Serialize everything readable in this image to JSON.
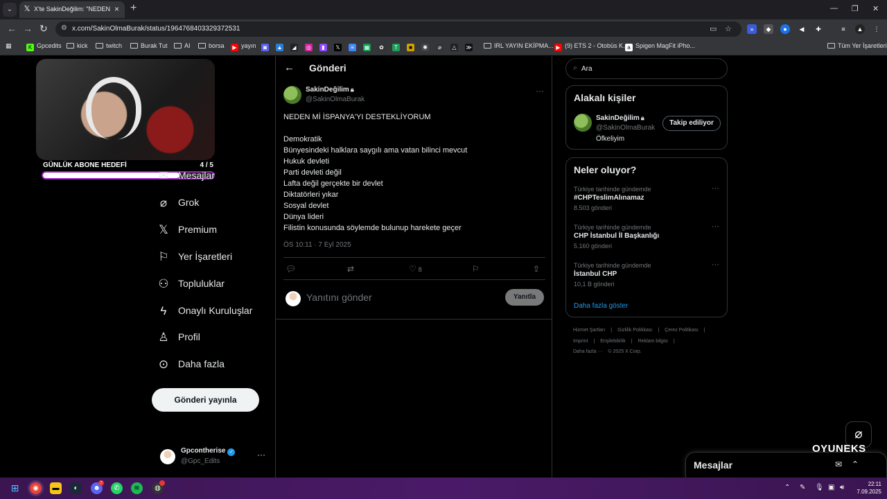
{
  "browser": {
    "tab_title": "X'te SakinDeğilim: \"NEDEN Mİ İSPANYA'YI DESTEKLİYORUM\"",
    "url": "x.com/SakinOlmaBurak/status/1964768403329372531",
    "bookmarks": [
      "Gpcedits",
      "kick",
      "twitch",
      "Burak Tut",
      "AI",
      "borsa",
      "yayın",
      "IRL YAYIN EKİPMA...",
      "(9) ETS 2 - Otobüs K...",
      "Spigen MagFit iPho...",
      "Tüm Yer İşaretleri"
    ]
  },
  "overlay": {
    "goal_label": "GÜNLÜK ABONE HEDEFİ",
    "goal_count": "4 / 5",
    "goal_progress": 0.8
  },
  "nav": {
    "items": [
      {
        "label": "Mesajlar",
        "icon": "mail-icon"
      },
      {
        "label": "Grok",
        "icon": "grok-icon"
      },
      {
        "label": "Premium",
        "icon": "x-logo-icon"
      },
      {
        "label": "Yer İşaretleri",
        "icon": "bookmark-icon"
      },
      {
        "label": "Topluluklar",
        "icon": "communities-icon"
      },
      {
        "label": "Onaylı Kuruluşlar",
        "icon": "lightning-icon"
      },
      {
        "label": "Profil",
        "icon": "profile-icon"
      },
      {
        "label": "Daha fazla",
        "icon": "more-circle-icon"
      }
    ],
    "post_button": "Gönderi yayınla",
    "account_name": "Gpcontherise",
    "account_handle": "@Gpc_Edits"
  },
  "post": {
    "header_title": "Gönderi",
    "author_name": "SakinDeğilim",
    "author_handle": "@SakinOlmaBurak",
    "lines": [
      "NEDEN Mİ İSPANYA'YI DESTEKLİYORUM",
      "",
      "Demokratik",
      "Bünyesindeki halklara saygılı ama vatan bilinci mevcut",
      "Hukuk devleti",
      "Parti devleti değil",
      "Lafta değil gerçekte bir devlet",
      "Diktatörleri yıkar",
      "Sosyal devlet",
      "Dünya lideri",
      "Filistin konusunda söylemde bulunup harekete geçer"
    ],
    "timestamp": "ÖS 10:11 · 7 Eyl 2025",
    "like_count": "8",
    "reply_placeholder": "Yanıtını gönder",
    "reply_button": "Yanıtla"
  },
  "sidebar": {
    "search_placeholder": "Ara",
    "related_title": "Alakalı kişiler",
    "related_name": "SakinDeğilim",
    "related_handle": "@SakinOlmaBurak",
    "related_bio": "Öfkeliyim",
    "follow_button": "Takip ediliyor",
    "trends_title": "Neler oluyor?",
    "trends": [
      {
        "context": "Türkiye tarihinde gündemde",
        "name": "#CHPTeslimAlınamaz",
        "count": "8.503 gönderi"
      },
      {
        "context": "Türkiye tarihinde gündemde",
        "name": "CHP İstanbul İl Başkanlığı",
        "count": "5.160 gönderi"
      },
      {
        "context": "Türkiye tarihinde gündemde",
        "name": "İstanbul CHP",
        "count": "10,1 B gönderi"
      }
    ],
    "show_more": "Daha fazla göster",
    "footer_row1": [
      "Hizmet Şartları",
      "|",
      "Gizlilik Politikası",
      "|",
      "Çerez Politikası",
      "|"
    ],
    "footer_row2": [
      "Imprint",
      "|",
      "Erişilebilirlik",
      "|",
      "Reklam bilgisi",
      "|"
    ],
    "footer_row3": [
      "Daha fazla ···",
      "© 2025 X Corp."
    ]
  },
  "messages_drawer": {
    "title": "Mesajlar"
  },
  "watermark": "OYUNEKS",
  "taskbar": {
    "time": "22:11",
    "date": "7.09.2025",
    "discord_badge": "7"
  }
}
